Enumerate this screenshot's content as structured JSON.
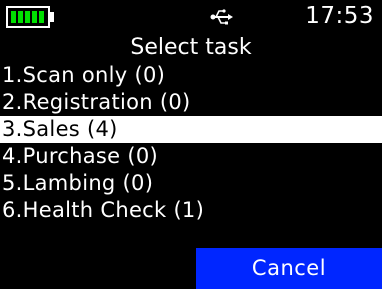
{
  "status_bar": {
    "battery_icon": "battery-full-icon",
    "battery_level_bars": 5,
    "battery_color": "#00e000",
    "connection_icon": "usb-icon",
    "time": "17:53"
  },
  "title": "Select task",
  "menu": {
    "selected_index": 2,
    "items": [
      {
        "label": "1.Scan only (0)"
      },
      {
        "label": "2.Registration (0)"
      },
      {
        "label": "3.Sales (4)"
      },
      {
        "label": "4.Purchase (0)"
      },
      {
        "label": "5.Lambing (0)"
      },
      {
        "label": "6.Health Check (1)"
      }
    ]
  },
  "softkeys": {
    "cancel_label": "Cancel",
    "cancel_color": "#0026ff"
  }
}
